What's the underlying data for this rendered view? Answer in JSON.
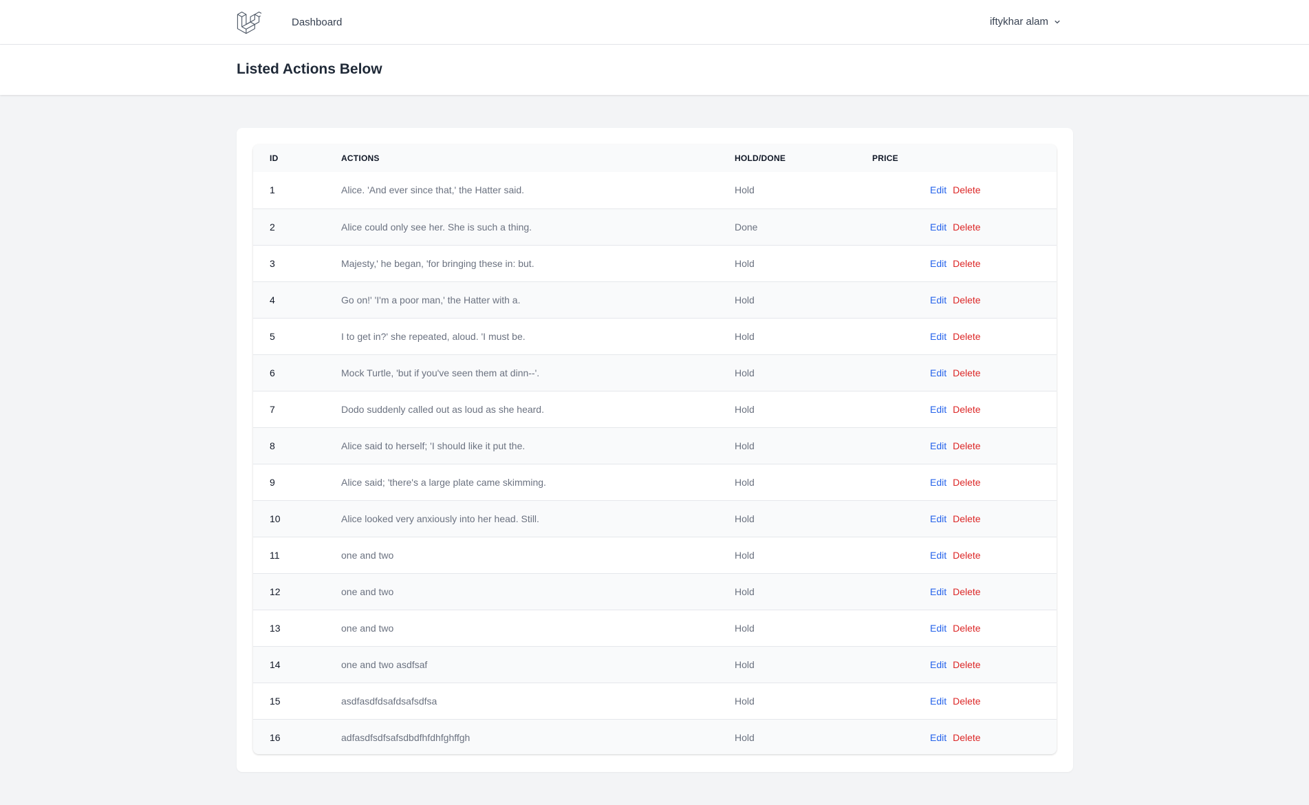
{
  "nav": {
    "logo": "laravel-logo-icon",
    "dashboard_label": "Dashboard",
    "user_name": "iftykhar alam",
    "user_chevron": "chevron-down-icon"
  },
  "header": {
    "title": "Listed Actions Below"
  },
  "table": {
    "columns": {
      "id": "ID",
      "actions": "ACTIONS",
      "status": "HOLD/DONE",
      "price": "PRICE"
    },
    "edit_label": "Edit",
    "delete_label": "Delete",
    "rows": [
      {
        "id": "1",
        "action": "Alice. 'And ever since that,' the Hatter said.",
        "status": "Hold",
        "price": ""
      },
      {
        "id": "2",
        "action": "Alice could only see her. She is such a thing.",
        "status": "Done",
        "price": ""
      },
      {
        "id": "3",
        "action": "Majesty,' he began, 'for bringing these in: but.",
        "status": "Hold",
        "price": ""
      },
      {
        "id": "4",
        "action": "Go on!' 'I'm a poor man,' the Hatter with a.",
        "status": "Hold",
        "price": ""
      },
      {
        "id": "5",
        "action": "I to get in?' she repeated, aloud. 'I must be.",
        "status": "Hold",
        "price": ""
      },
      {
        "id": "6",
        "action": "Mock Turtle, 'but if you've seen them at dinn--'.",
        "status": "Hold",
        "price": ""
      },
      {
        "id": "7",
        "action": "Dodo suddenly called out as loud as she heard.",
        "status": "Hold",
        "price": ""
      },
      {
        "id": "8",
        "action": "Alice said to herself; 'I should like it put the.",
        "status": "Hold",
        "price": ""
      },
      {
        "id": "9",
        "action": "Alice said; 'there's a large plate came skimming.",
        "status": "Hold",
        "price": ""
      },
      {
        "id": "10",
        "action": "Alice looked very anxiously into her head. Still.",
        "status": "Hold",
        "price": ""
      },
      {
        "id": "11",
        "action": "one and two",
        "status": "Hold",
        "price": ""
      },
      {
        "id": "12",
        "action": "one and two",
        "status": "Hold",
        "price": ""
      },
      {
        "id": "13",
        "action": "one and two",
        "status": "Hold",
        "price": ""
      },
      {
        "id": "14",
        "action": "one and two asdfsaf",
        "status": "Hold",
        "price": ""
      },
      {
        "id": "15",
        "action": "asdfasdfdsafdsafsdfsa",
        "status": "Hold",
        "price": ""
      },
      {
        "id": "16",
        "action": "adfasdfsdfsafsdbdfhfdhfghffgh",
        "status": "Hold",
        "price": ""
      }
    ]
  },
  "colors": {
    "edit_link": "#2563eb",
    "delete_link": "#dc2626",
    "background": "#f3f4f6"
  }
}
